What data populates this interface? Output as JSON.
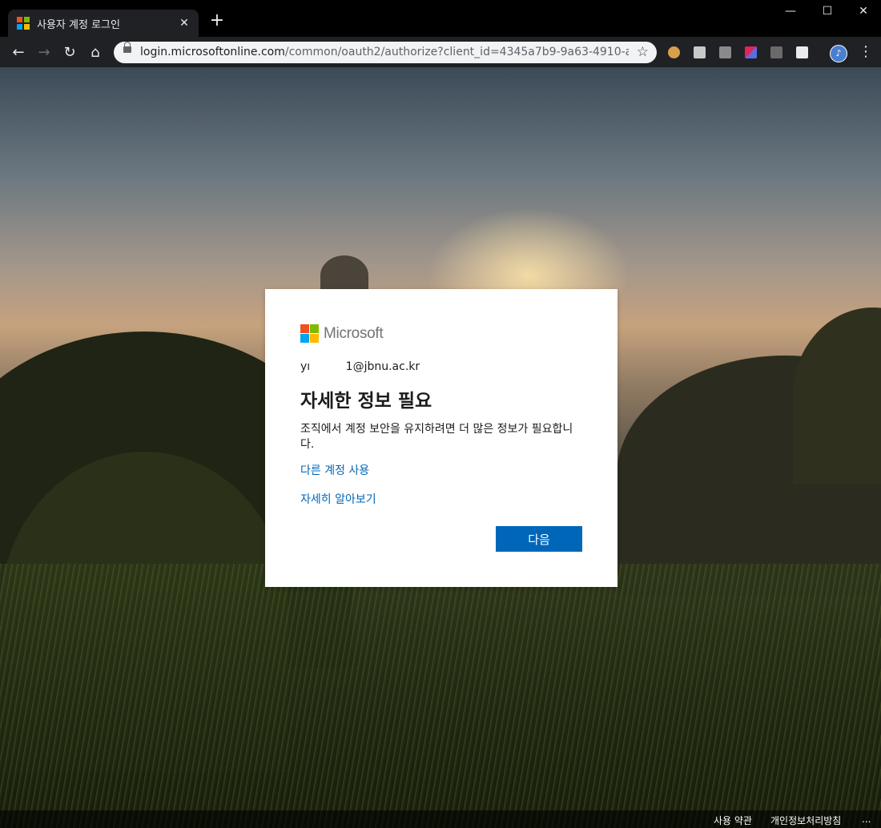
{
  "browser": {
    "tab_title": "사용자 계정 로그인",
    "tab_close": "✕",
    "new_tab": "+",
    "window_minimize": "—",
    "window_maximize": "☐",
    "window_close": "✕",
    "url_host": "login.microsoftonline.com",
    "url_path": "/common/oauth2/authorize?client_id=4345a7b9-9a63-4910-a426-3...",
    "colors": {
      "chrome_dark": "#202124",
      "omnibox": "#f1f3f4"
    }
  },
  "card": {
    "brand": "Microsoft",
    "brand_colors": [
      "#f25022",
      "#7fba00",
      "#00a4ef",
      "#ffb900"
    ],
    "identity": "yı          1@jbnu.ac.kr",
    "heading": "자세한 정보 필요",
    "description": "조직에서 계정 보안을 유지하려면 더 많은 정보가 필요합니다.",
    "link_other_account": "다른 계정 사용",
    "link_learn_more": "자세히 알아보기",
    "next_button": "다음",
    "accent_color": "#0067b8"
  },
  "footer": {
    "terms": "사용 약관",
    "privacy": "개인정보처리방침",
    "more": "..."
  }
}
